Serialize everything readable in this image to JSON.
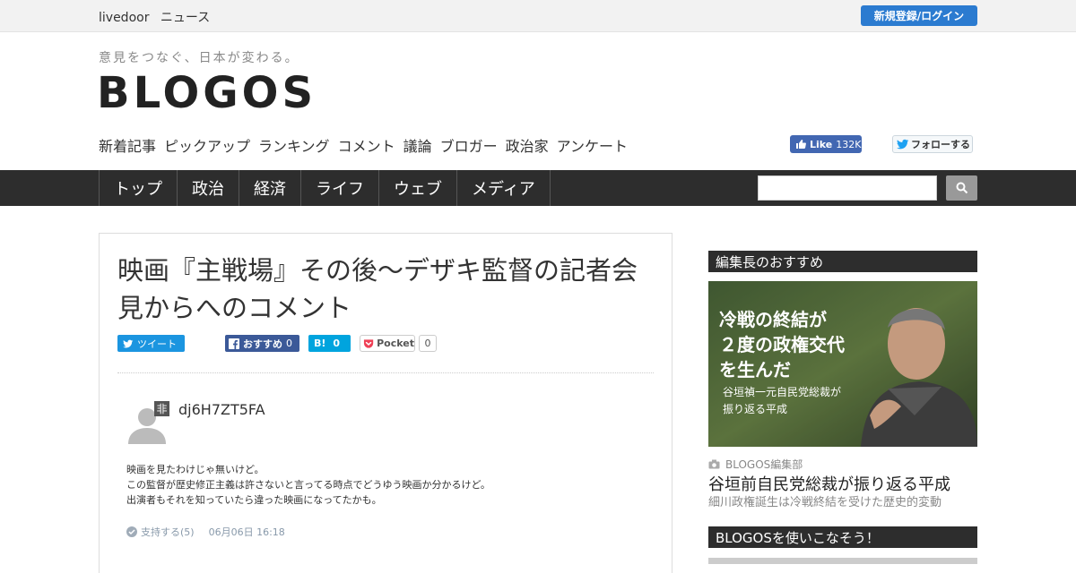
{
  "topbar": {
    "brand_1": "livedoor",
    "brand_2": "ニュース",
    "login": "新規登録/ログイン"
  },
  "header": {
    "tagline": "意見をつなぐ、日本が変わる。",
    "logo": "BLOGOS",
    "subnav": [
      "新着記事",
      "ピックアップ",
      "ランキング",
      "コメント",
      "議論",
      "ブロガー",
      "政治家",
      "アンケート"
    ],
    "fb_like": "Like",
    "fb_like_count": "132K",
    "tw_follow": "フォローする"
  },
  "mainnav": [
    "トップ",
    "政治",
    "経済",
    "ライフ",
    "ウェブ",
    "メディア"
  ],
  "article": {
    "title": "映画『主戦場』その後〜デザキ監督の記者会見からへのコメント",
    "tweet": "ツイート",
    "fb_recommend": "おすすめ",
    "fb_count": "0",
    "hatena": "B!",
    "hatena_count": "0",
    "pocket": "Pocket",
    "pocket_count": "0"
  },
  "comment": {
    "badge": "非",
    "user": "dj6H7ZT5FA",
    "lines": [
      "映画を見たわけじゃ無いけど。",
      "この監督が歴史修正主義は許さないと言ってる時点でどうゆう映画か分かるけど。",
      "出演者もそれを知っていたら違った映画になってたかも。"
    ],
    "support": "支持する(5)",
    "date": "06月06日 16:18"
  },
  "sidebar": {
    "editor_heading": "編集長のおすすめ",
    "feature_overlay_1": "冷戦の終結が",
    "feature_overlay_2": "２度の政権交代",
    "feature_overlay_3": "を生んだ",
    "feature_overlay_sub1": "谷垣禎一元自民党総裁が",
    "feature_overlay_sub2": "振り返る平成",
    "feature_source": "BLOGOS編集部",
    "feature_title": "谷垣前自民党総裁が振り返る平成",
    "feature_sub": "細川政権誕生は冷戦終結を受けた歴史的変動",
    "howto_heading": "BLOGOSを使いこなそう！"
  }
}
